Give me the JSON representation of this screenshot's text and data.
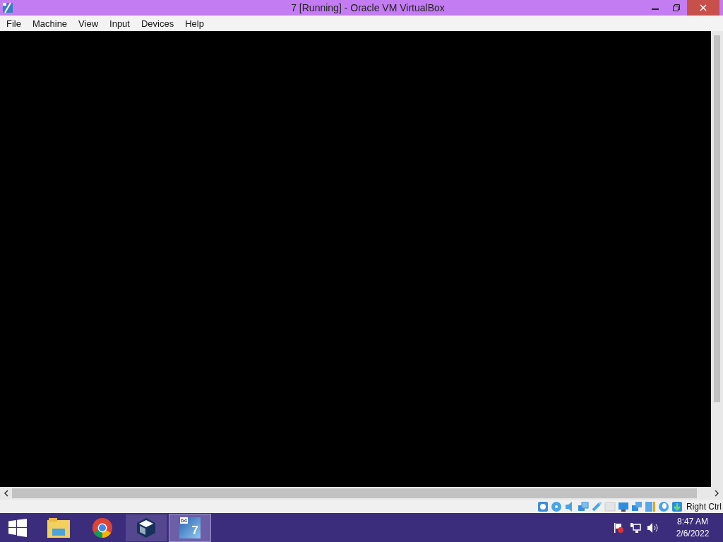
{
  "window": {
    "title": "7 [Running] - Oracle VM VirtualBox"
  },
  "menu": [
    "File",
    "Machine",
    "View",
    "Input",
    "Devices",
    "Help"
  ],
  "status_bar": {
    "host_key": "Right Ctrl"
  },
  "taskbar": {
    "apps": [
      {
        "kind": "folder",
        "selected": false,
        "open": false
      },
      {
        "kind": "browser",
        "selected": false,
        "open": false
      },
      {
        "kind": "virtualbox",
        "selected": false,
        "open": true
      },
      {
        "kind": "vm",
        "selected": true,
        "open": true,
        "badge": "64",
        "label": "7"
      }
    ],
    "clock": {
      "time": "8:47 AM",
      "date": "2/6/2022"
    }
  }
}
